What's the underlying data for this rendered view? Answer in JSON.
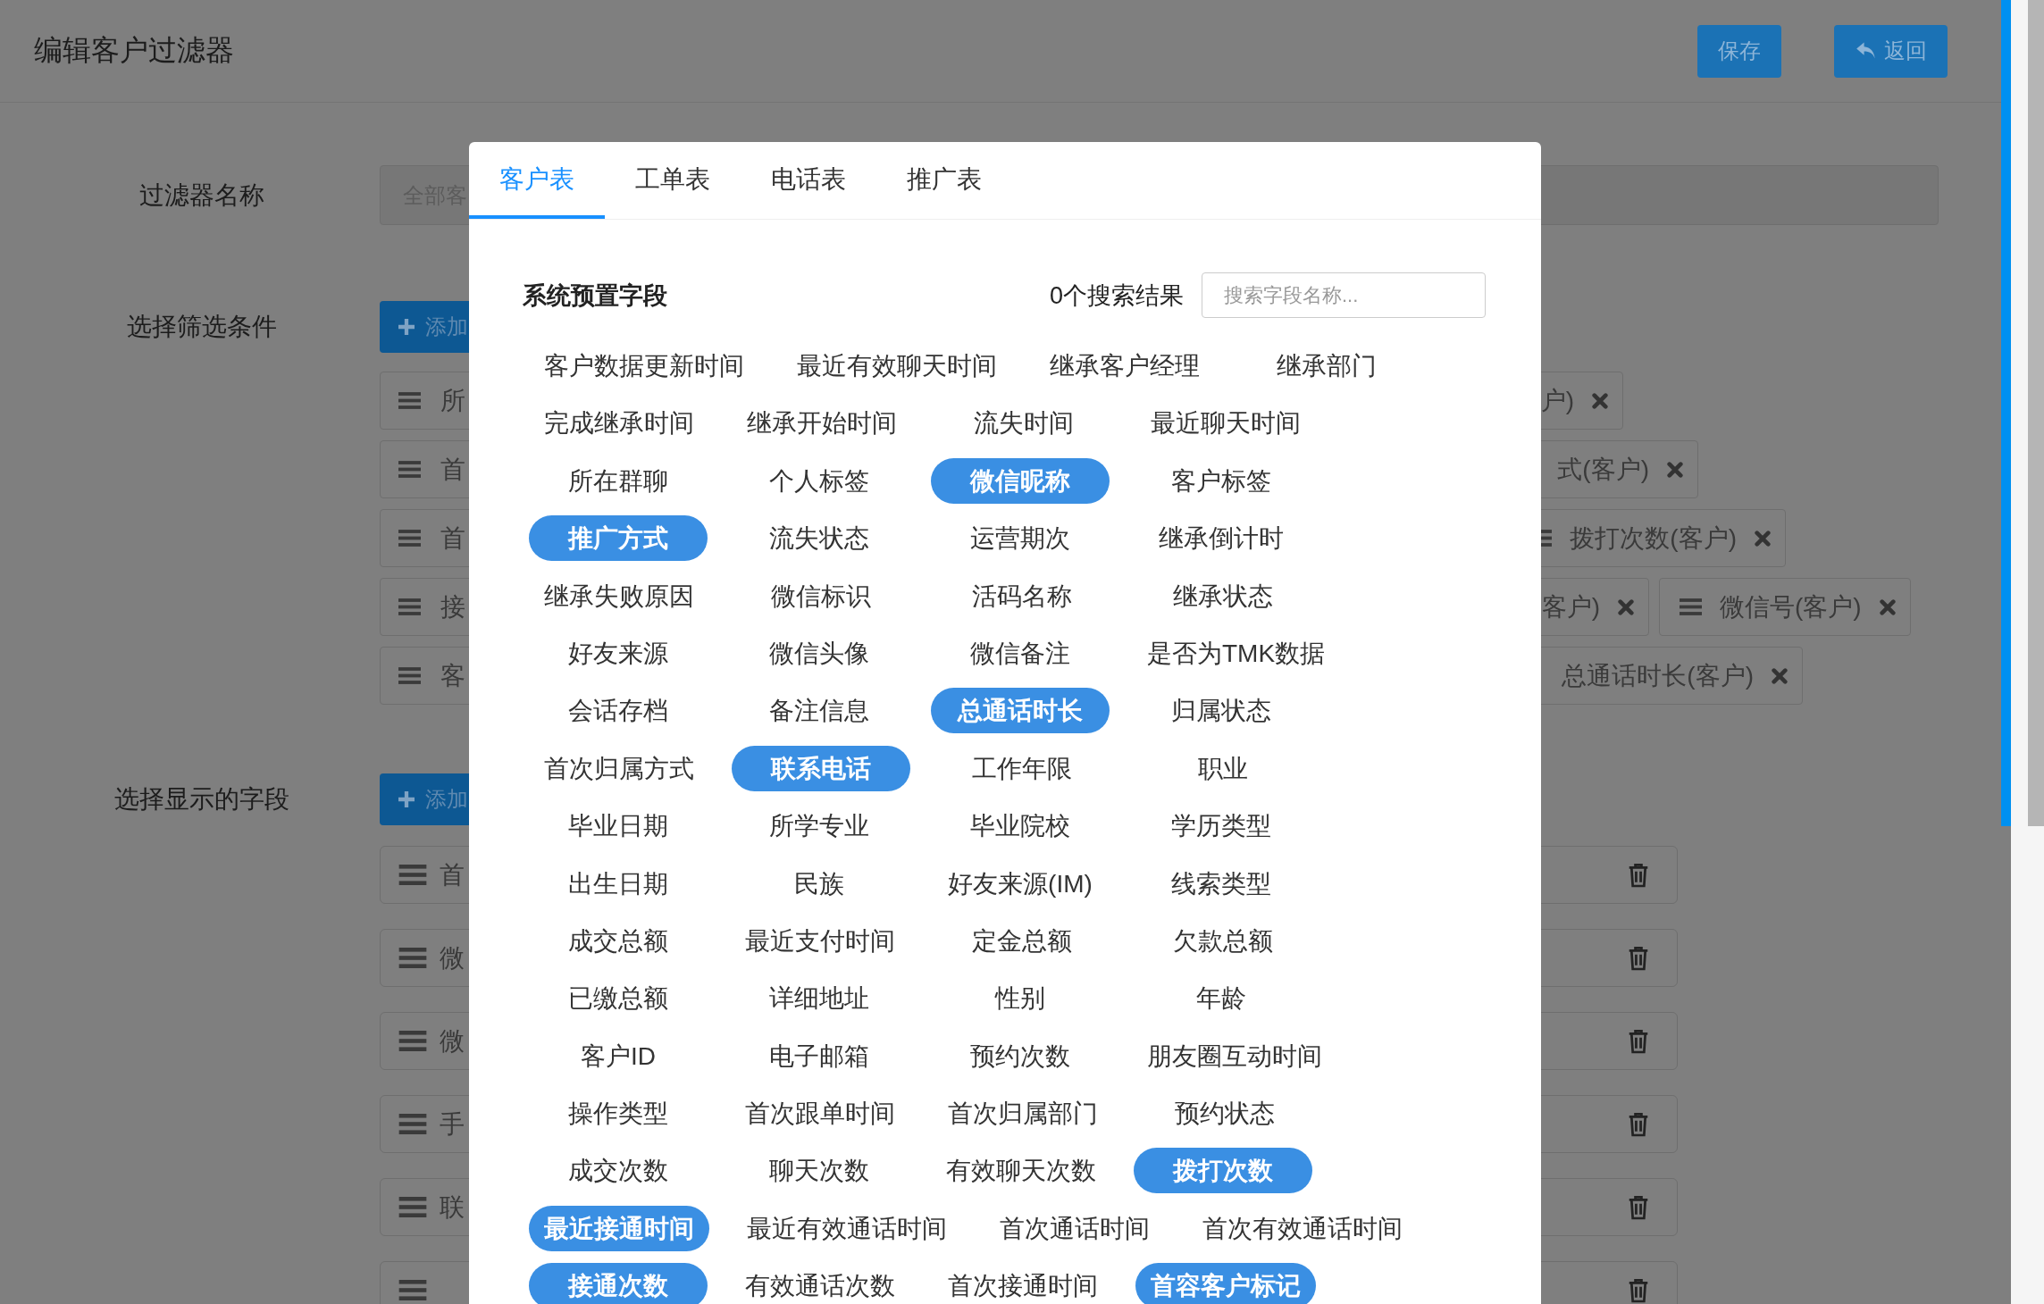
{
  "header": {
    "title": "编辑客户过滤器",
    "buttons": [
      {
        "label": "保存",
        "kind": "primary"
      },
      {
        "label": "返回",
        "kind": "back"
      }
    ]
  },
  "filter_name": {
    "label": "过滤器名称",
    "value": "全部客"
  },
  "filter_conditions": {
    "label": "选择筛选条件",
    "add_button": "添加",
    "rows": [
      [
        {
          "kind": "left",
          "text": "所"
        },
        {
          "kind": "right",
          "text": "户)"
        }
      ],
      [
        {
          "kind": "left",
          "text": "首"
        },
        {
          "kind": "right",
          "text": "式(客户)"
        }
      ],
      [
        {
          "kind": "left",
          "text": "首"
        },
        {
          "kind": "right-handle",
          "text": "拨打次数(客户)"
        }
      ],
      [
        {
          "kind": "left",
          "text": "接"
        },
        {
          "kind": "right",
          "text": "客户)"
        },
        {
          "kind": "right-handle",
          "text": "微信号(客户)"
        }
      ],
      [
        {
          "kind": "left",
          "text": "客"
        },
        {
          "kind": "right",
          "text": "总通话时长(客户)"
        }
      ]
    ]
  },
  "display_fields": {
    "label": "选择显示的字段",
    "add_button": "添加",
    "rows": [
      {
        "text": "首"
      },
      {
        "text": "微"
      },
      {
        "text": "微"
      },
      {
        "text": "手"
      },
      {
        "text": "联"
      },
      {}
    ]
  },
  "modal": {
    "tabs": [
      {
        "label": "客户表",
        "selected": true
      },
      {
        "label": "工单表",
        "selected": false
      },
      {
        "label": "电话表",
        "selected": false
      },
      {
        "label": "推广表",
        "selected": false
      }
    ],
    "section_title": "系统预置字段",
    "result_count": "0个搜索结果",
    "search": {
      "placeholder": "搜索字段名称..."
    },
    "field_rows": [
      [
        {
          "label": "客户数据更新时间",
          "selected": false
        },
        {
          "label": "最近有效聊天时间",
          "selected": false
        },
        {
          "label": "继承客户经理",
          "selected": false
        },
        {
          "label": "继承部门",
          "selected": false
        }
      ],
      [
        {
          "label": "完成继承时间",
          "selected": false
        },
        {
          "label": "继承开始时间",
          "selected": false
        },
        {
          "label": "流失时间",
          "selected": false
        },
        {
          "label": "最近聊天时间",
          "selected": false
        }
      ],
      [
        {
          "label": "所在群聊",
          "selected": false
        },
        {
          "label": "个人标签",
          "selected": false
        },
        {
          "label": "微信昵称",
          "selected": true
        },
        {
          "label": "客户标签",
          "selected": false
        }
      ],
      [
        {
          "label": "推广方式",
          "selected": true
        },
        {
          "label": "流失状态",
          "selected": false
        },
        {
          "label": "运营期次",
          "selected": false
        },
        {
          "label": "继承倒计时",
          "selected": false
        }
      ],
      [
        {
          "label": "继承失败原因",
          "selected": false
        },
        {
          "label": "微信标识",
          "selected": false
        },
        {
          "label": "活码名称",
          "selected": false
        },
        {
          "label": "继承状态",
          "selected": false
        }
      ],
      [
        {
          "label": "好友来源",
          "selected": false
        },
        {
          "label": "微信头像",
          "selected": false
        },
        {
          "label": "微信备注",
          "selected": false
        },
        {
          "label": "是否为TMK数据",
          "selected": false
        }
      ],
      [
        {
          "label": "会话存档",
          "selected": false
        },
        {
          "label": "备注信息",
          "selected": false
        },
        {
          "label": "总通话时长",
          "selected": true
        },
        {
          "label": "归属状态",
          "selected": false
        }
      ],
      [
        {
          "label": "首次归属方式",
          "selected": false
        },
        {
          "label": "联系电话",
          "selected": true
        },
        {
          "label": "工作年限",
          "selected": false
        },
        {
          "label": "职业",
          "selected": false
        }
      ],
      [
        {
          "label": "毕业日期",
          "selected": false
        },
        {
          "label": "所学专业",
          "selected": false
        },
        {
          "label": "毕业院校",
          "selected": false
        },
        {
          "label": "学历类型",
          "selected": false
        }
      ],
      [
        {
          "label": "出生日期",
          "selected": false
        },
        {
          "label": "民族",
          "selected": false
        },
        {
          "label": "好友来源(IM)",
          "selected": false
        },
        {
          "label": "线索类型",
          "selected": false
        }
      ],
      [
        {
          "label": "成交总额",
          "selected": false
        },
        {
          "label": "最近支付时间",
          "selected": false
        },
        {
          "label": "定金总额",
          "selected": false
        },
        {
          "label": "欠款总额",
          "selected": false
        }
      ],
      [
        {
          "label": "已缴总额",
          "selected": false
        },
        {
          "label": "详细地址",
          "selected": false
        },
        {
          "label": "性别",
          "selected": false
        },
        {
          "label": "年龄",
          "selected": false
        }
      ],
      [
        {
          "label": "客户ID",
          "selected": false
        },
        {
          "label": "电子邮箱",
          "selected": false
        },
        {
          "label": "预约次数",
          "selected": false
        },
        {
          "label": "朋友圈互动时间",
          "selected": false
        }
      ],
      [
        {
          "label": "操作类型",
          "selected": false
        },
        {
          "label": "首次跟单时间",
          "selected": false
        },
        {
          "label": "首次归属部门",
          "selected": false
        },
        {
          "label": "预约状态",
          "selected": false
        }
      ],
      [
        {
          "label": "成交次数",
          "selected": false
        },
        {
          "label": "聊天次数",
          "selected": false
        },
        {
          "label": "有效聊天次数",
          "selected": false
        },
        {
          "label": "拨打次数",
          "selected": true
        }
      ],
      [
        {
          "label": "最近接通时间",
          "selected": true
        },
        {
          "label": "最近有效通话时间",
          "selected": false
        },
        {
          "label": "首次通话时间",
          "selected": false
        },
        {
          "label": "首次有效通话时间",
          "selected": false
        }
      ],
      [
        {
          "label": "接通次数",
          "selected": true
        },
        {
          "label": "有效通话次数",
          "selected": false
        },
        {
          "label": "首次接通时间",
          "selected": false
        },
        {
          "label": "首容客户标记",
          "selected": true
        }
      ]
    ]
  }
}
